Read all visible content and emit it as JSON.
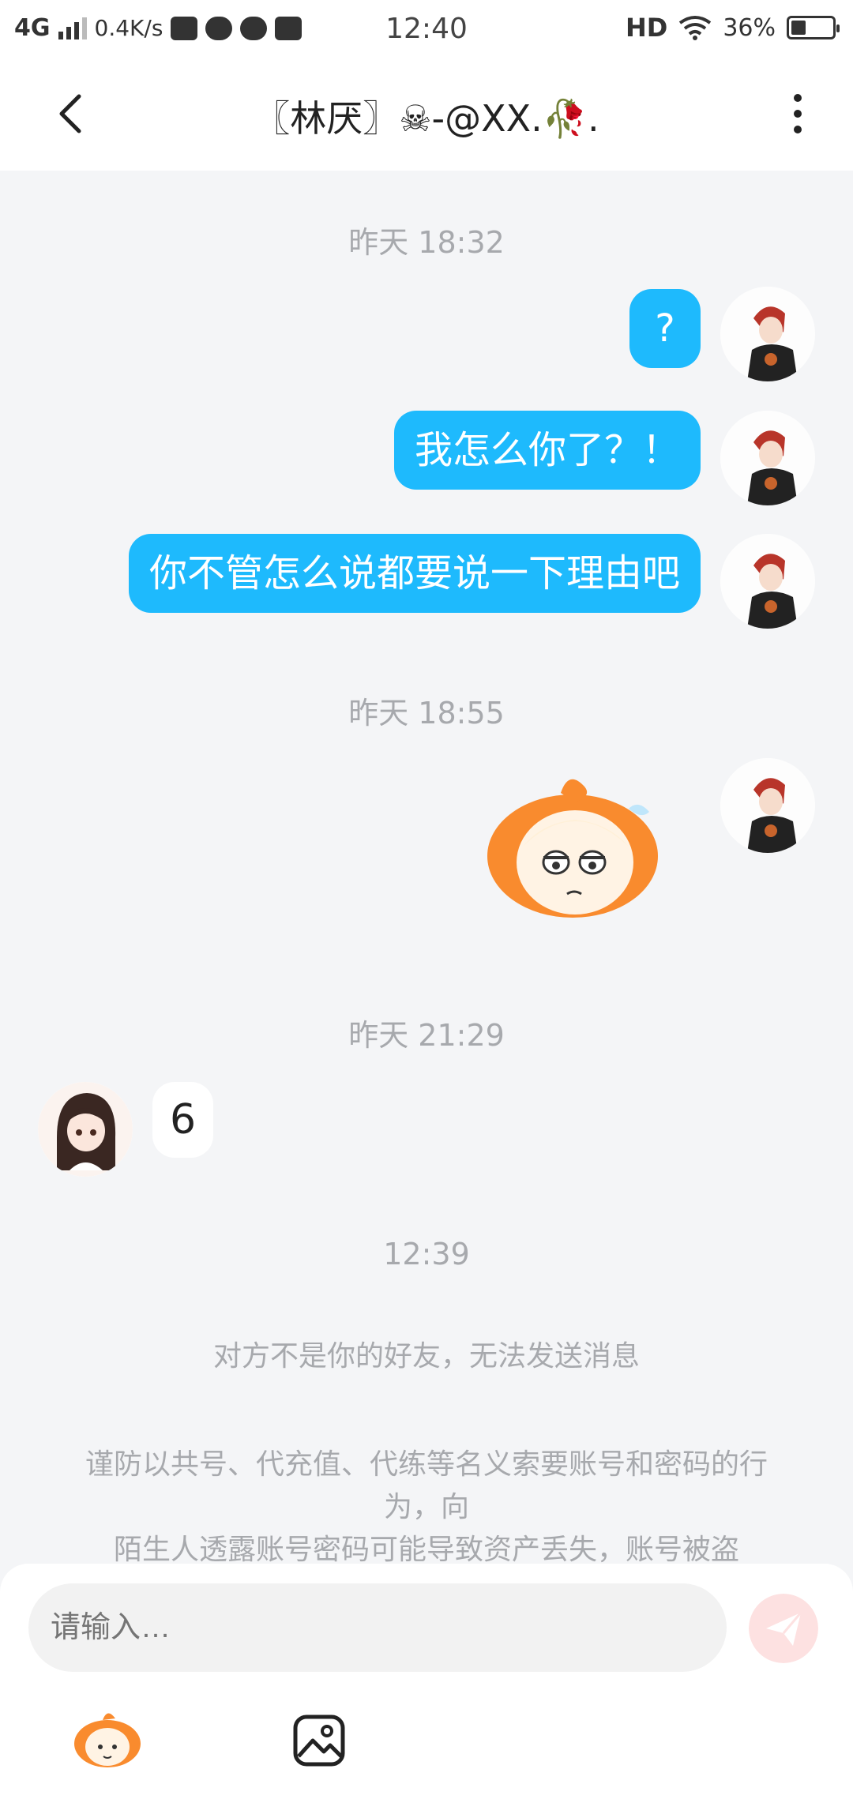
{
  "status_bar": {
    "network": "4G",
    "speed": "0.4K/s",
    "time": "12:40",
    "hd": "HD",
    "battery": "36%",
    "battery_level": 0.36
  },
  "header": {
    "title": "〖林厌〗☠-@XX.🥀."
  },
  "chat": {
    "timestamps": [
      "昨天 18:32",
      "昨天 18:55",
      "昨天 21:29",
      "12:39"
    ],
    "outgoing": [
      "?",
      "我怎么你了？！",
      "你不管怎么说都要说一下理由吧"
    ],
    "incoming": [
      "6"
    ]
  },
  "system": {
    "not_friend": "对方不是你的好友，无法发送消息",
    "warning_line1": "谨防以共号、代充值、代练等名义索要账号和密码的行为，向",
    "warning_line2": "陌生人透露账号密码可能导致资产丢失，账号被盗"
  },
  "input": {
    "placeholder": "请输入…"
  },
  "colors": {
    "accent": "#1ebafd",
    "background": "#f4f5f7",
    "muted_text": "#a7a9ad",
    "send_disabled": "#fde1e1"
  }
}
